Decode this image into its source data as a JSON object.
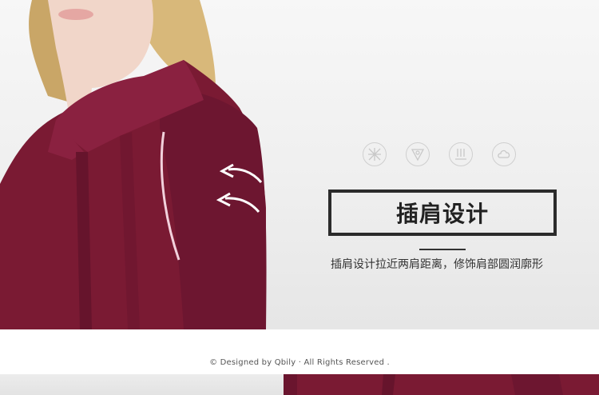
{
  "feature": {
    "title": "插肩设计",
    "description": "插肩设计拉近两肩距离，修饰肩部圆润廓形"
  },
  "icons": [
    {
      "name": "breathable-icon"
    },
    {
      "name": "soft-icon"
    },
    {
      "name": "drape-icon"
    },
    {
      "name": "comfort-icon"
    }
  ],
  "footer": {
    "copyright": "© Designed by Qbily · All Rights Reserved ."
  },
  "colors": {
    "garment": "#7a1a33",
    "background": "#efefef",
    "frame": "#2b2b2b",
    "text": "#333333",
    "icon_stroke": "#cfcfcf"
  }
}
